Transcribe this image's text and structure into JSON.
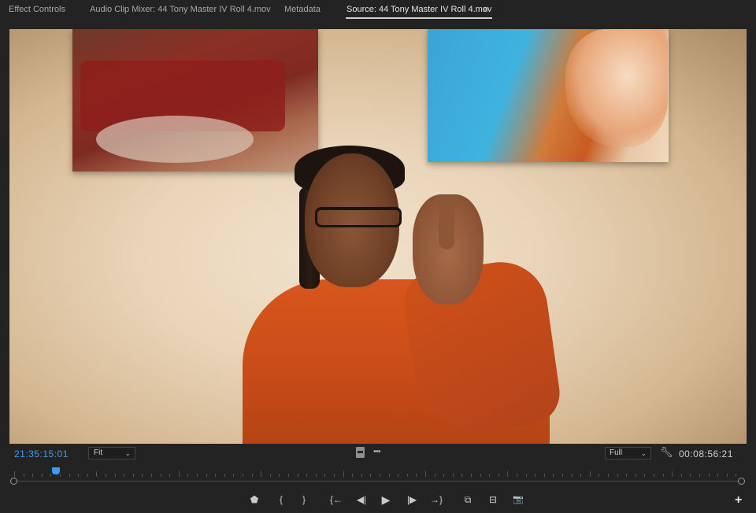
{
  "tabs": [
    {
      "label": "Effect Controls",
      "active": false
    },
    {
      "label": "Audio Clip Mixer: 44 Tony Master IV Roll 4.mov",
      "active": false
    },
    {
      "label": "Metadata",
      "active": false
    },
    {
      "label": "Source: 44 Tony Master IV Roll 4.mov",
      "active": true
    }
  ],
  "tab_menu_glyph": "≡",
  "viewer": {
    "playhead_timecode": "21:35:15:01",
    "zoom_value": "Fit",
    "resolution_value": "Full",
    "duration_timecode": "00:08:56:21",
    "playhead_position": 0.057
  },
  "icons": {
    "tab_menu": "hamburger-icon",
    "zoom_chevron": "chevron-down-icon",
    "resolution_chevron": "chevron-down-icon",
    "settings": "wrench-icon",
    "drag_video": "filmstrip-icon",
    "drag_audio": "waveform-icon",
    "add": "plus-icon"
  },
  "transport": {
    "add_marker": "⬟",
    "mark_in": "{",
    "mark_out": "}",
    "go_to_in": "{←",
    "step_back": "◀|",
    "play": "▶",
    "step_forward": "|▶",
    "go_to_out": "→}",
    "insert": "⧉",
    "overwrite": "⊟",
    "export_frame": "📷",
    "add_button": "+"
  },
  "colors": {
    "accent_blue": "#3d9df3",
    "background": "#232323"
  }
}
